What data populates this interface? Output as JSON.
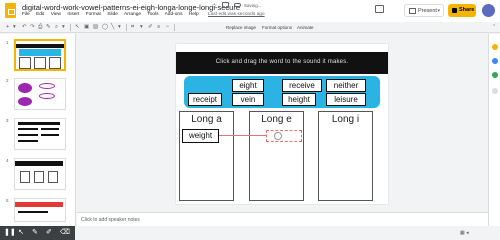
{
  "app": {
    "title": "digital-word-work-vowel-patterns-ei-eigh-longa-longe-longi-secure",
    "saving_status": "Saving...",
    "last_edit": "Last edit was seconds ago",
    "present_label": "Present",
    "share_label": "Share",
    "colors": {
      "brand": "#f4b400",
      "banner": "#111111",
      "panel": "#2bb3e3"
    }
  },
  "menu": [
    "File",
    "Edit",
    "View",
    "Insert",
    "Format",
    "Slide",
    "Arrange",
    "Tools",
    "Add-ons",
    "Help"
  ],
  "toolbar": {
    "icons": [
      "add-icon",
      "undo-icon",
      "redo-icon",
      "print-icon",
      "paint-format-icon",
      "zoom-icon",
      "select-icon",
      "textbox-icon",
      "image-icon",
      "shape-icon",
      "line-icon",
      "border-color-icon",
      "border-weight-icon"
    ],
    "replace_image": "Replace image",
    "format_options": "Format options",
    "animate": "Animate"
  },
  "filmstrip": {
    "slide_numbers": [
      "1",
      "2",
      "3",
      "4",
      "5"
    ]
  },
  "slide": {
    "banner_text": "Click and drag the word to the sound it makes.",
    "words": [
      "eight",
      "receive",
      "neither",
      "receipt",
      "vein",
      "height",
      "leisure"
    ],
    "dragging_word": "weight",
    "columns": [
      "Long a",
      "Long e",
      "Long i"
    ]
  },
  "notes": {
    "placeholder": "Click to add speaker notes"
  }
}
